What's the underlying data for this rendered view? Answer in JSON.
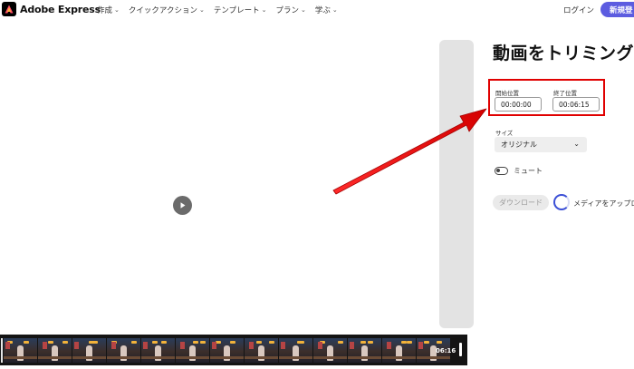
{
  "header": {
    "brand": "Adobe Express",
    "nav": [
      {
        "label": "作成"
      },
      {
        "label": "クイックアクション"
      },
      {
        "label": "テンプレート"
      },
      {
        "label": "プラン"
      },
      {
        "label": "学ぶ"
      }
    ],
    "login": "ログイン",
    "signup": "新規登"
  },
  "editor": {
    "title": "動画をトリミング",
    "start_label": "開始位置",
    "start_value": "00:00:00",
    "end_label": "終了位置",
    "end_value": "00:06:15",
    "size_label": "サイズ",
    "size_value": "オリジナル",
    "mute_label": "ミュート",
    "download_label": "ダウンロード",
    "upload_status": "メディアをアップロ"
  },
  "timeline": {
    "duration": "06:16"
  },
  "colors": {
    "accent": "#5c5ce0",
    "highlight": "#e00000",
    "spinner": "#3b4fd6"
  }
}
